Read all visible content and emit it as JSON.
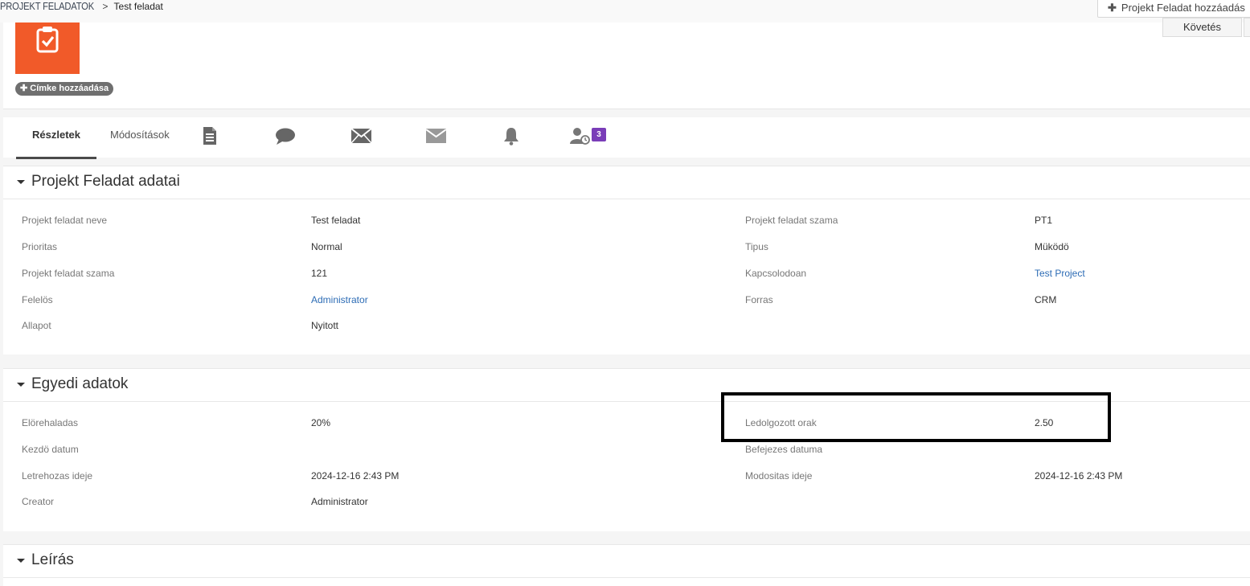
{
  "breadcrumb": {
    "module": "PROJEKT FELADATOK",
    "separator": ">",
    "record": "Test feladat"
  },
  "header": {
    "add_button_label": "Projekt Feladat hozzáadás",
    "follow_button_label": "Követés",
    "tag_button_label": "Címke hozzáadása",
    "brand_color": "#f15a29"
  },
  "tabs": {
    "details": "Részletek",
    "history": "Módosítások",
    "icons": [
      "document-icon",
      "comment-icon",
      "email-icon",
      "envelope-icon",
      "bell-icon",
      "user-clock-icon"
    ],
    "user_badge_count": "3"
  },
  "block1": {
    "title": "Projekt Feladat adatai",
    "rows": [
      {
        "label_left": "Projekt feladat neve",
        "value_left": "Test feladat",
        "label_right": "Projekt feladat szama",
        "value_right": "PT1"
      },
      {
        "label_left": "Prioritas",
        "value_left": "Normal",
        "label_right": "Tipus",
        "value_right": "Müködö"
      },
      {
        "label_left": "Projekt feladat szama",
        "value_left": "121",
        "label_right": "Kapcsolodoan",
        "value_right": "Test Project"
      },
      {
        "label_left": "Felelös",
        "value_left": "Administrator",
        "label_right": "Forras",
        "value_right": "CRM"
      },
      {
        "label_left": "Allapot",
        "value_left": "Nyitott"
      }
    ]
  },
  "block2": {
    "title": "Egyedi adatok",
    "rows": [
      {
        "label_left": "Elörehaladas",
        "value_left": "20%",
        "label_right": "Ledolgozott orak",
        "value_right": "2.50"
      },
      {
        "label_left": "Kezdö datum",
        "value_left": "",
        "label_right": "Befejezes datuma",
        "value_right": ""
      },
      {
        "label_left": "Letrehozas ideje",
        "value_left": "2024-12-16 2:43 PM",
        "label_right": "Modositas ideje",
        "value_right": "2024-12-16 2:43 PM"
      },
      {
        "label_left": "Creator",
        "value_left": "Administrator"
      }
    ]
  },
  "block3": {
    "title": "Leírás"
  }
}
